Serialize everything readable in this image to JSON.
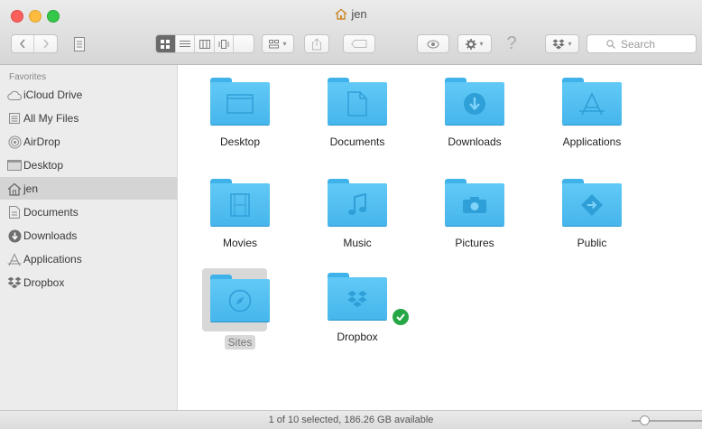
{
  "window": {
    "title": "jen"
  },
  "toolbar": {
    "search_placeholder": "Search"
  },
  "sidebar": {
    "section_title": "Favorites",
    "items": [
      {
        "label": "iCloud Drive",
        "icon": "cloud-icon"
      },
      {
        "label": "All My Files",
        "icon": "all-files-icon"
      },
      {
        "label": "AirDrop",
        "icon": "airdrop-icon"
      },
      {
        "label": "Desktop",
        "icon": "desktop-icon"
      },
      {
        "label": "jen",
        "icon": "home-icon",
        "selected": true
      },
      {
        "label": "Documents",
        "icon": "documents-icon"
      },
      {
        "label": "Downloads",
        "icon": "downloads-icon"
      },
      {
        "label": "Applications",
        "icon": "applications-icon"
      },
      {
        "label": "Dropbox",
        "icon": "dropbox-icon"
      }
    ]
  },
  "content": {
    "items": [
      {
        "label": "Desktop",
        "icon": "desktop-folder-icon"
      },
      {
        "label": "Documents",
        "icon": "documents-folder-icon"
      },
      {
        "label": "Downloads",
        "icon": "downloads-folder-icon"
      },
      {
        "label": "Applications",
        "icon": "applications-folder-icon"
      },
      {
        "label": "Movies",
        "icon": "movies-folder-icon"
      },
      {
        "label": "Music",
        "icon": "music-folder-icon"
      },
      {
        "label": "Pictures",
        "icon": "pictures-folder-icon"
      },
      {
        "label": "Public",
        "icon": "public-folder-icon"
      },
      {
        "label": "Sites",
        "icon": "sites-folder-icon",
        "selected": true
      },
      {
        "label": "Dropbox",
        "icon": "dropbox-folder-icon",
        "badge": "synced-check-icon"
      }
    ]
  },
  "statusbar": {
    "text": "1 of 10 selected, 186.26 GB available"
  },
  "colors": {
    "folder": "#4fbcf0",
    "selection": "#d4d4d4",
    "sync_badge": "#26a745"
  }
}
